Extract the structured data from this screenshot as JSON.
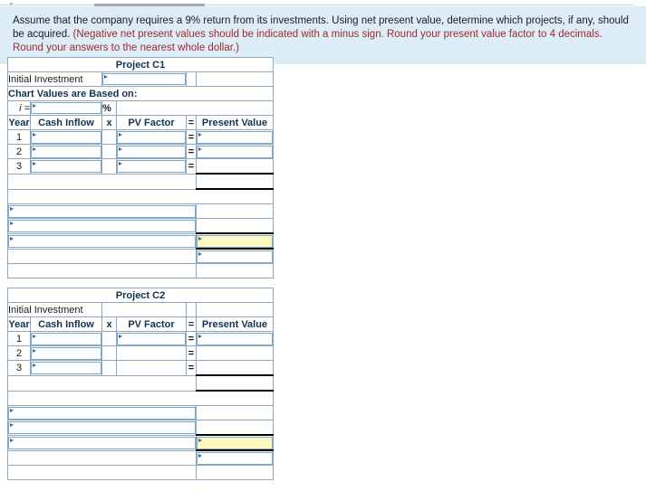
{
  "instructions": {
    "plain": "Assume that the company requires a 9% return from its investments. Using net present value, determine which projects, if any, should be acquired. ",
    "note": "(Negative net present values should be indicated with a minus sign. Round your present value factor to 4 decimals. Round your answers to the nearest whole dollar.)"
  },
  "colors": {
    "banner_bg": "#dcedf7",
    "header_blue": "#7eb0de",
    "note_red": "#9e2a2b",
    "highlight_yellow": "#fcf8bf",
    "input_border": "#7ba7cd"
  },
  "columns": {
    "year": "Year",
    "cash_inflow": "Cash Inflow",
    "times": "x",
    "pv_factor": "PV Factor",
    "equals": "=",
    "present_value": "Present Value"
  },
  "labels": {
    "initial_investment": "Initial Investment",
    "chart_values_based_on": "Chart Values are Based on:",
    "i_equals": "i =",
    "percent": "%"
  },
  "projects": [
    {
      "title": "Project C1",
      "has_chart_values_row": true,
      "has_rate_row": true,
      "initial_investment_input": true,
      "rows": [
        {
          "year": "1",
          "cash_input": true,
          "factor_input": true,
          "equals": "=",
          "pv_input": true
        },
        {
          "year": "2",
          "cash_input": true,
          "factor_input": true,
          "equals": "=",
          "pv_input": true
        },
        {
          "year": "3",
          "cash_input": true,
          "factor_input": true,
          "equals": "=",
          "pv_input": false
        }
      ],
      "summary_rows": [
        {
          "left_input": true,
          "right_input": false,
          "right_yellow": false
        },
        {
          "left_input": true,
          "right_input": false,
          "right_yellow": false
        },
        {
          "left_input": true,
          "right_input": true,
          "right_yellow": true
        },
        {
          "left_input": false,
          "right_input": true,
          "right_yellow": false
        },
        {
          "left_input": false,
          "right_input": false,
          "right_yellow": false
        }
      ]
    },
    {
      "title": "Project C2",
      "has_chart_values_row": false,
      "has_rate_row": false,
      "initial_investment_input": false,
      "rows": [
        {
          "year": "1",
          "cash_input": true,
          "factor_input": true,
          "equals": "=",
          "pv_input": true
        },
        {
          "year": "2",
          "cash_input": true,
          "factor_input": false,
          "equals": "=",
          "pv_input": false
        },
        {
          "year": "3",
          "cash_input": true,
          "factor_input": false,
          "equals": "=",
          "pv_input": false
        }
      ],
      "summary_rows": [
        {
          "left_input": true,
          "right_input": false,
          "right_yellow": false
        },
        {
          "left_input": true,
          "right_input": false,
          "right_yellow": false
        },
        {
          "left_input": true,
          "right_input": true,
          "right_yellow": true
        },
        {
          "left_input": false,
          "right_input": true,
          "right_yellow": false
        },
        {
          "left_input": false,
          "right_input": false,
          "right_yellow": false
        }
      ]
    }
  ]
}
